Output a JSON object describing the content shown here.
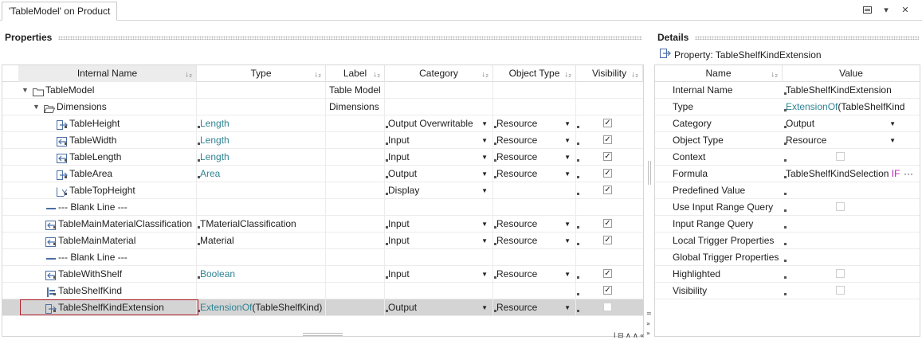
{
  "window": {
    "tab_title": "'TableModel' on Product",
    "controls": [
      "window-list-icon",
      "chevron-down-icon",
      "close-icon"
    ]
  },
  "properties_panel": {
    "title": "Properties",
    "columns": [
      {
        "label": "Internal Name",
        "sort": "↓₂"
      },
      {
        "label": "Type",
        "sort": "↓₂"
      },
      {
        "label": "Label",
        "sort": "↓₂"
      },
      {
        "label": "Category",
        "sort": "↓₂"
      },
      {
        "label": "Object Type",
        "sort": "↓₂"
      },
      {
        "label": "Visibility",
        "sort": "↓₂"
      }
    ],
    "rows": [
      {
        "level": 0,
        "expander": "◢",
        "icon": "folder-icon",
        "name": "TableModel",
        "type": "",
        "type_link": false,
        "label": "Table Model",
        "category": "",
        "object_type": "",
        "visible": null
      },
      {
        "level": 1,
        "expander": "◢",
        "icon": "folder-open-icon",
        "name": "Dimensions",
        "type": "",
        "type_link": false,
        "label": "Dimensions",
        "category": "",
        "object_type": "",
        "visible": null
      },
      {
        "level": 2,
        "icon": "output-property-icon",
        "name": "TableHeight",
        "type": "Length",
        "type_link": true,
        "label": "",
        "category": "Output Overwritable",
        "object_type": "Resource",
        "visible": true
      },
      {
        "level": 2,
        "icon": "input-property-icon",
        "name": "TableWidth",
        "type": "Length",
        "type_link": true,
        "label": "",
        "category": "Input",
        "object_type": "Resource",
        "visible": true
      },
      {
        "level": 2,
        "icon": "input-property-icon",
        "name": "TableLength",
        "type": "Length",
        "type_link": true,
        "label": "",
        "category": "Input",
        "object_type": "Resource",
        "visible": true
      },
      {
        "level": 2,
        "icon": "output-property-icon",
        "name": "TableArea",
        "type": "Area",
        "type_link": true,
        "label": "",
        "category": "Output",
        "object_type": "Resource",
        "visible": true
      },
      {
        "level": 2,
        "icon": "display-property-icon",
        "name": "TableTopHeight",
        "type": "",
        "type_link": false,
        "label": "",
        "category": "Display",
        "object_type": "",
        "visible": true
      },
      {
        "level": 1,
        "icon": "blank-line-icon",
        "name": "--- Blank Line ---",
        "type": "",
        "type_link": false,
        "label": "",
        "category": "",
        "object_type": "",
        "visible": null,
        "blank": true
      },
      {
        "level": 1,
        "icon": "input-property-icon",
        "name": "TableMainMaterialClassification",
        "type": "TMaterialClassification",
        "type_link": false,
        "label": "",
        "category": "Input",
        "object_type": "Resource",
        "visible": true
      },
      {
        "level": 1,
        "icon": "input-property-icon",
        "name": "TableMainMaterial",
        "type": "Material",
        "type_link": false,
        "label": "",
        "category": "Input",
        "object_type": "Resource",
        "visible": true
      },
      {
        "level": 1,
        "icon": "blank-line-icon",
        "name": "--- Blank Line ---",
        "type": "",
        "type_link": false,
        "label": "",
        "category": "",
        "object_type": "",
        "visible": null,
        "blank": true
      },
      {
        "level": 1,
        "icon": "input-property-icon",
        "name": "TableWithShelf",
        "type": "Boolean",
        "type_link": true,
        "label": "",
        "category": "Input",
        "object_type": "Resource",
        "visible": true
      },
      {
        "level": 1,
        "icon": "kind-property-icon",
        "name": "TableShelfKind",
        "type": "",
        "type_link": false,
        "label": "",
        "category": "",
        "object_type": "",
        "visible": true
      },
      {
        "level": 1,
        "icon": "output-property-icon",
        "name": "TableShelfKindExtension",
        "type": "ExtensionOf",
        "type_suffix": "(TableShelfKind)",
        "type_link": true,
        "label": "",
        "category": "Output",
        "object_type": "Resource",
        "visible": false,
        "selected": true
      }
    ]
  },
  "details_panel": {
    "title": "Details",
    "subtitle": "Property: TableShelfKindExtension",
    "columns": [
      {
        "label": "Name",
        "sort": "↓₂"
      },
      {
        "label": "Value"
      }
    ],
    "rows": [
      {
        "name": "Internal Name",
        "value": "TableShelfKindExtension",
        "kind": "text"
      },
      {
        "name": "Type",
        "value": "ExtensionOf",
        "value_suffix": "(TableShelfKind",
        "kind": "link"
      },
      {
        "name": "Category",
        "value": "Output",
        "kind": "dropdown"
      },
      {
        "name": "Object Type",
        "value": "Resource",
        "kind": "dropdown"
      },
      {
        "name": "Context",
        "value": "",
        "kind": "checkbox",
        "checked": false
      },
      {
        "name": "Formula",
        "value": "TableShelfKindSelection ",
        "value_suffix": "IF",
        "kind": "formula",
        "more": "···"
      },
      {
        "name": "Predefined Value",
        "value": "",
        "kind": "text"
      },
      {
        "name": "Use Input Range Query",
        "value": "",
        "kind": "checkbox-disabled",
        "checked": false
      },
      {
        "name": "Input Range Query",
        "value": "",
        "kind": "text"
      },
      {
        "name": "Local Trigger Properties",
        "value": "",
        "kind": "text"
      },
      {
        "name": "Global Trigger Properties",
        "value": "",
        "kind": "text"
      },
      {
        "name": "Highlighted",
        "value": "",
        "kind": "checkbox-disabled",
        "checked": false
      },
      {
        "name": "Visibility",
        "value": "",
        "kind": "checkbox",
        "checked": false
      }
    ]
  },
  "colors": {
    "link": "#2f8393",
    "selected_row": "#d4d4d4",
    "selected_border": "#b2202b",
    "formula_keyword": "#c01bc0"
  }
}
